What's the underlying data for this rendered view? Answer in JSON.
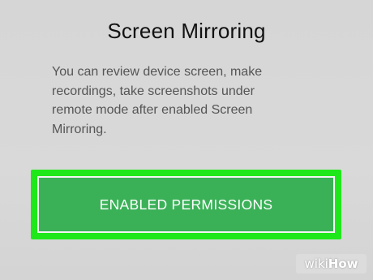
{
  "dialog": {
    "title": "Screen Mirroring",
    "message": "You can review device screen, make recordings, take screenshots under remote mode after enabled Screen Mirroring.",
    "confirm_label": "ENABLED PERMISSIONS"
  },
  "watermark": {
    "part1": "wiki",
    "part2": "How"
  },
  "colors": {
    "background": "#d8d8d8",
    "button": "#3ab157",
    "highlight": "#1fe81a",
    "title_text": "#111111",
    "body_text": "#555555"
  }
}
